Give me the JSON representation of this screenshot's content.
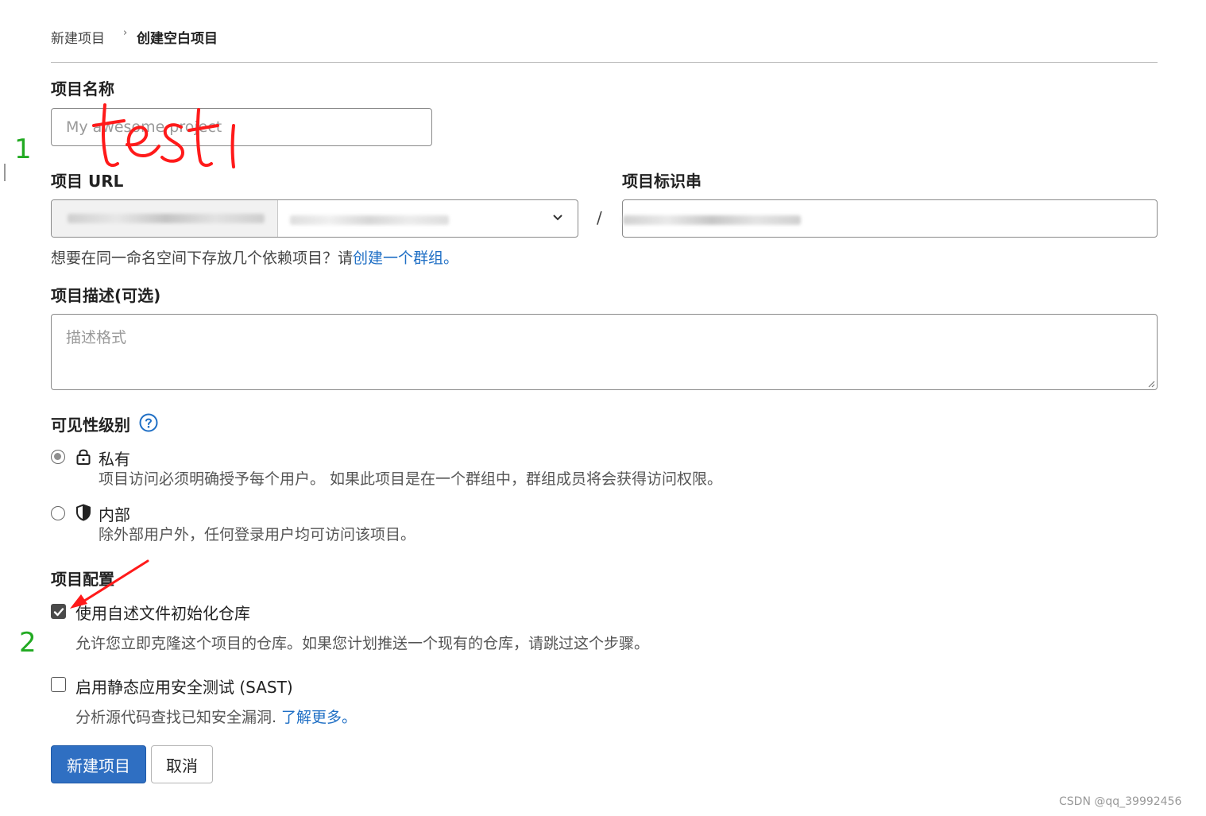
{
  "breadcrumb": {
    "parent": "新建项目",
    "separator": "›",
    "current": "创建空白项目"
  },
  "project_name": {
    "label": "项目名称",
    "placeholder": "My awesome project",
    "handwritten_value": "test1"
  },
  "project_url": {
    "label": "项目 URL",
    "separator": "/"
  },
  "project_slug": {
    "label": "项目标识串"
  },
  "group_hint": {
    "text": "想要在同一命名空间下存放几个依赖项目？请",
    "link": "创建一个群组。"
  },
  "description": {
    "label": "项目描述(可选)",
    "placeholder": "描述格式"
  },
  "visibility": {
    "label": "可见性级别",
    "help_icon": "question-circle-icon",
    "options": [
      {
        "icon": "lock-icon",
        "title": "私有",
        "desc": "项目访问必须明确授予每个用户。 如果此项目是在一个群组中，群组成员将会获得访问权限。",
        "selected": true
      },
      {
        "icon": "shield-icon",
        "title": "内部",
        "desc": "除外部用户外，任何登录用户均可访问该项目。",
        "selected": false
      }
    ]
  },
  "config": {
    "label": "项目配置",
    "options": [
      {
        "title": "使用自述文件初始化仓库",
        "desc": "允许您立即克隆这个项目的仓库。如果您计划推送一个现有的仓库，请跳过这个步骤。",
        "checked": true
      },
      {
        "title": "启用静态应用安全测试 (SAST)",
        "desc": "分析源代码查找已知安全漏洞.",
        "link": "了解更多。",
        "checked": false
      }
    ]
  },
  "buttons": {
    "create": "新建项目",
    "cancel": "取消"
  },
  "annotations": {
    "one": "1",
    "two": "2"
  },
  "watermark": "CSDN @qq_39992456",
  "colors": {
    "primary": "#2f6fc2",
    "link": "#1f6fc5",
    "annotation_red": "#ff1a1a",
    "annotation_green": "#22aa22"
  }
}
